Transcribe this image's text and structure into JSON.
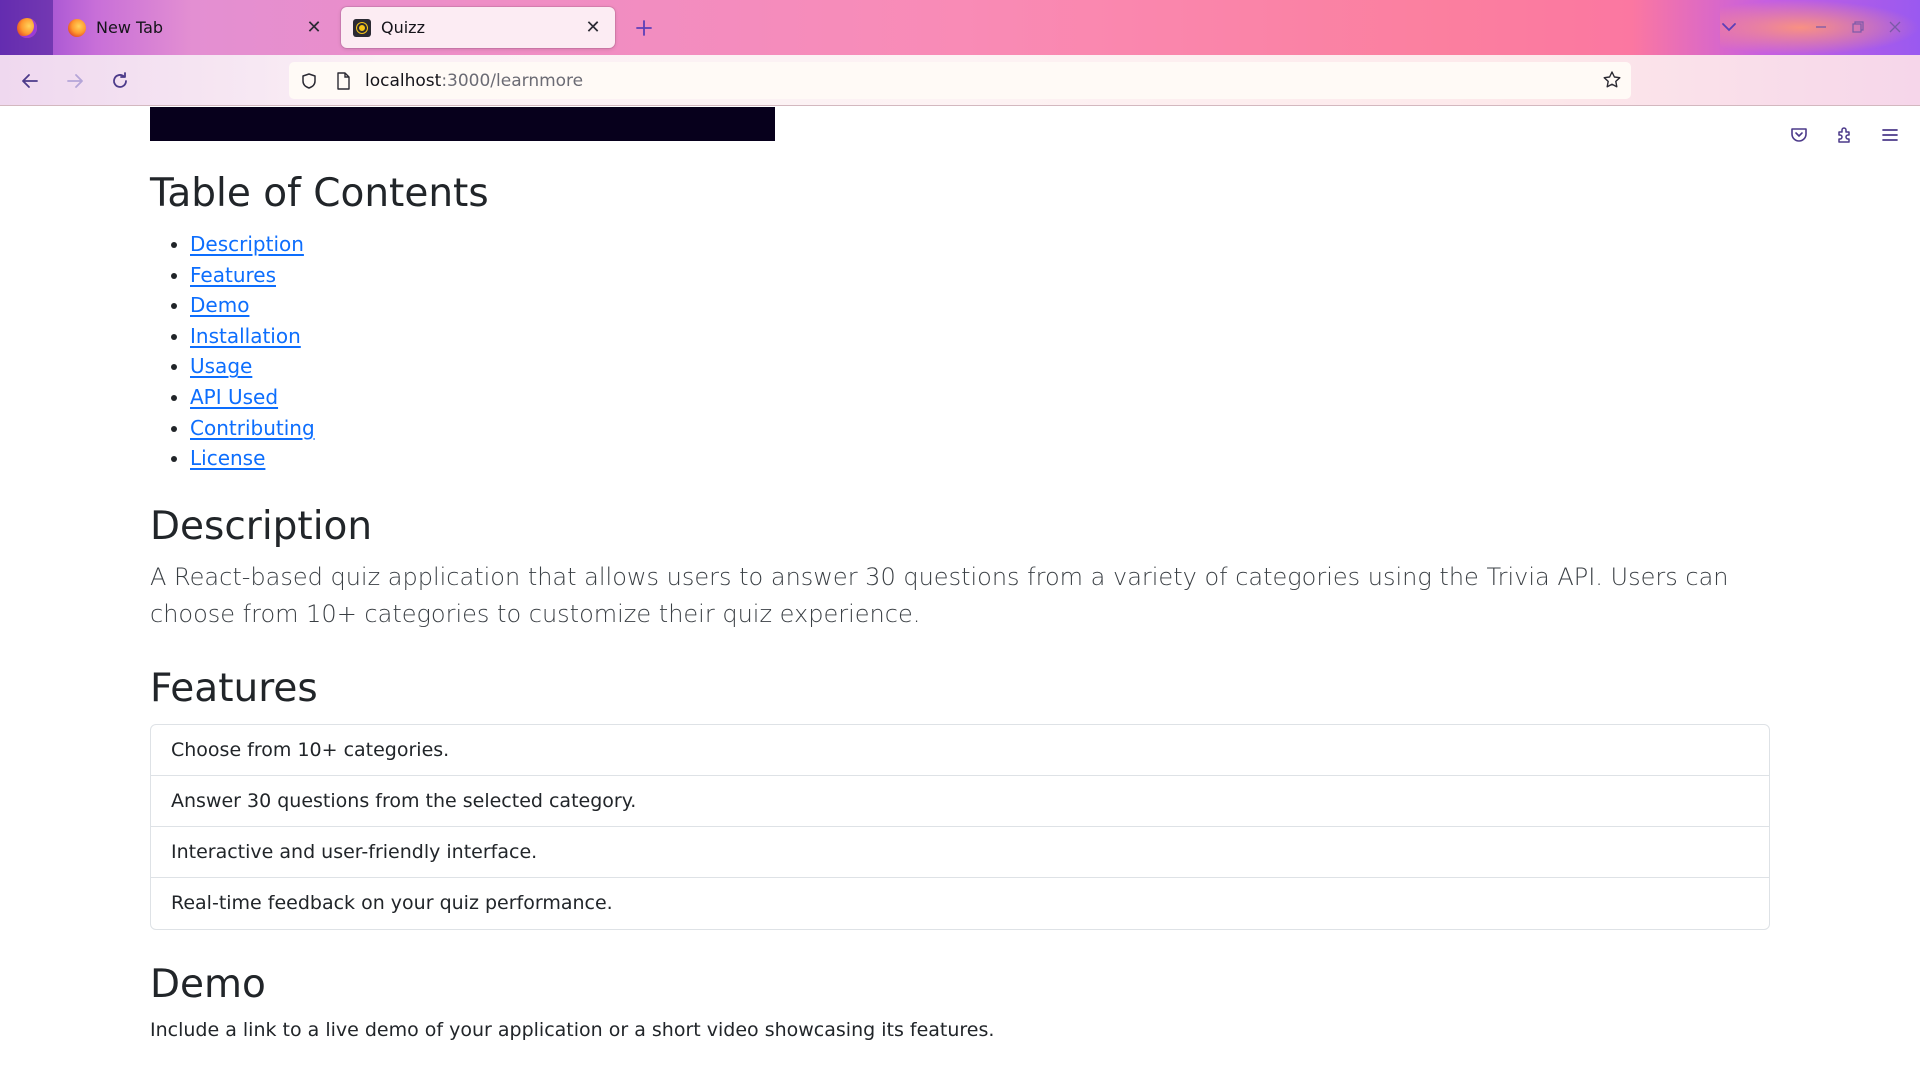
{
  "browser": {
    "tabs": [
      {
        "title": "New Tab",
        "icon": "firefox-icon",
        "active": false
      },
      {
        "title": "Quizz",
        "icon": "quiz-favicon-icon",
        "active": true
      }
    ],
    "url": {
      "host": "localhost",
      "rest": ":3000/learnmore"
    },
    "accent": "#5b3fb8"
  },
  "page": {
    "toc": {
      "title": "Table of Contents",
      "items": [
        "Description",
        "Features",
        "Demo",
        "Installation",
        "Usage",
        "API Used",
        "Contributing",
        "License"
      ]
    },
    "description": {
      "title": "Description",
      "text": "A React-based quiz application that allows users to answer 30 questions from a variety of categories using the Trivia API. Users can choose from 10+ categories to customize their quiz experience."
    },
    "features": {
      "title": "Features",
      "items": [
        "Choose from 10+ categories.",
        "Answer 30 questions from the selected category.",
        "Interactive and user-friendly interface.",
        "Real-time feedback on your quiz performance."
      ]
    },
    "demo": {
      "title": "Demo",
      "text": "Include a link to a live demo of your application or a short video showcasing its features."
    },
    "link_color": "#0d6efd"
  }
}
